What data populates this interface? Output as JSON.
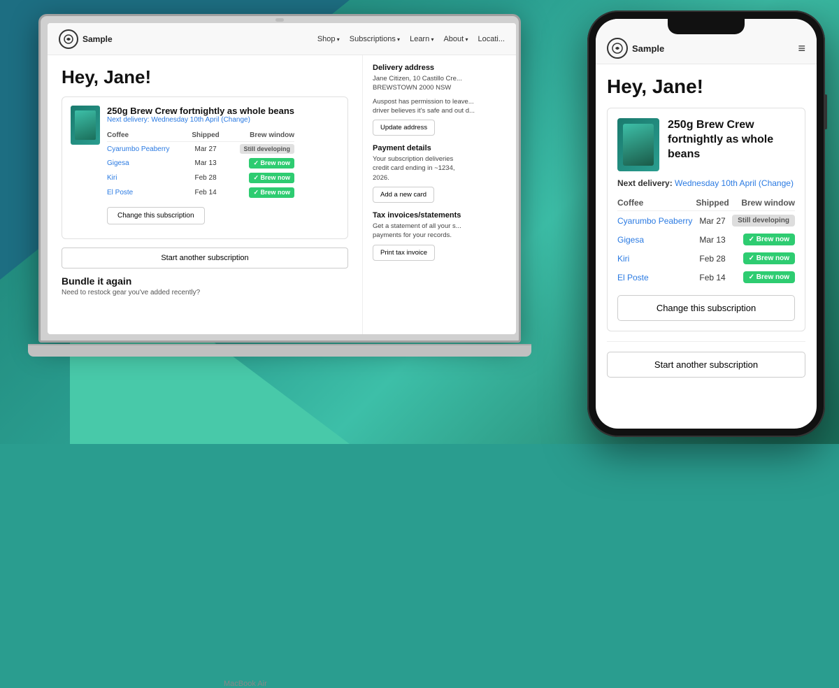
{
  "background": {
    "color1": "#1d6e82",
    "color2": "#2a9d8f"
  },
  "laptop": {
    "label": "MacBook Air",
    "nav": {
      "logo_text": "Sample",
      "items": [
        "Shop",
        "Subscriptions",
        "Learn",
        "About",
        "Locati..."
      ]
    },
    "main": {
      "greeting": "Hey, Jane!",
      "subscription": {
        "title": "250g Brew Crew fortnightly as whole beans",
        "next_delivery_label": "Next delivery:",
        "next_delivery_value": "Wednesday 10th April",
        "change_label": "(Change)",
        "table_headers": [
          "Coffee",
          "Shipped",
          "Brew window"
        ],
        "coffees": [
          {
            "name": "Cyarumbo Peaberry",
            "shipped": "Mar 27",
            "status": "Still developing",
            "status_type": "gray"
          },
          {
            "name": "Gigesa",
            "shipped": "Mar 13",
            "status": "Brew now",
            "status_type": "green"
          },
          {
            "name": "Kiri",
            "shipped": "Feb 28",
            "status": "Brew now",
            "status_type": "green"
          },
          {
            "name": "El Poste",
            "shipped": "Feb 14",
            "status": "Brew now",
            "status_type": "green"
          }
        ],
        "change_btn": "Change this subscription"
      },
      "start_btn": "Start another subscription",
      "bundle": {
        "title": "Bundle it again",
        "subtitle": "Need to restock gear you've added recently?"
      }
    },
    "sidebar": {
      "delivery": {
        "title": "Delivery address",
        "address": "Jane Citizen, 10 Castillo Cre...\nBREWSTOWN 2000 NSW",
        "note": "Auspost has permission to leave...\ndriver believes it's safe and out d...",
        "btn": "Update address"
      },
      "payment": {
        "title": "Payment details",
        "text": "Your subscription deliveries\ncredit card ending in ~1234,\n2026.",
        "btn": "Add a new card"
      },
      "tax": {
        "title": "Tax invoices/statements",
        "text": "Get a statement of all your s...\npayments for your records.",
        "btn": "Print tax invoice"
      }
    }
  },
  "phone": {
    "nav": {
      "logo_text": "Sample"
    },
    "main": {
      "greeting": "Hey, Jane!",
      "subscription": {
        "title": "250g Brew Crew fortnightly as whole beans",
        "next_delivery_label": "Next delivery:",
        "next_delivery_value": "Wednesday 10th April",
        "change_label": "(Change)",
        "table_headers": [
          "Coffee",
          "Shipped",
          "Brew window"
        ],
        "coffees": [
          {
            "name": "Cyarumbo Peaberry",
            "shipped": "Mar 27",
            "status": "Still developing",
            "status_type": "gray"
          },
          {
            "name": "Gigesa",
            "shipped": "Mar 13",
            "status": "Brew now",
            "status_type": "green"
          },
          {
            "name": "Kiri",
            "shipped": "Feb 28",
            "status": "Brew now",
            "status_type": "green"
          },
          {
            "name": "El Poste",
            "shipped": "Feb 14",
            "status": "Brew now",
            "status_type": "green"
          }
        ],
        "change_btn": "Change this subscription"
      },
      "start_btn": "Start another subscription"
    }
  }
}
